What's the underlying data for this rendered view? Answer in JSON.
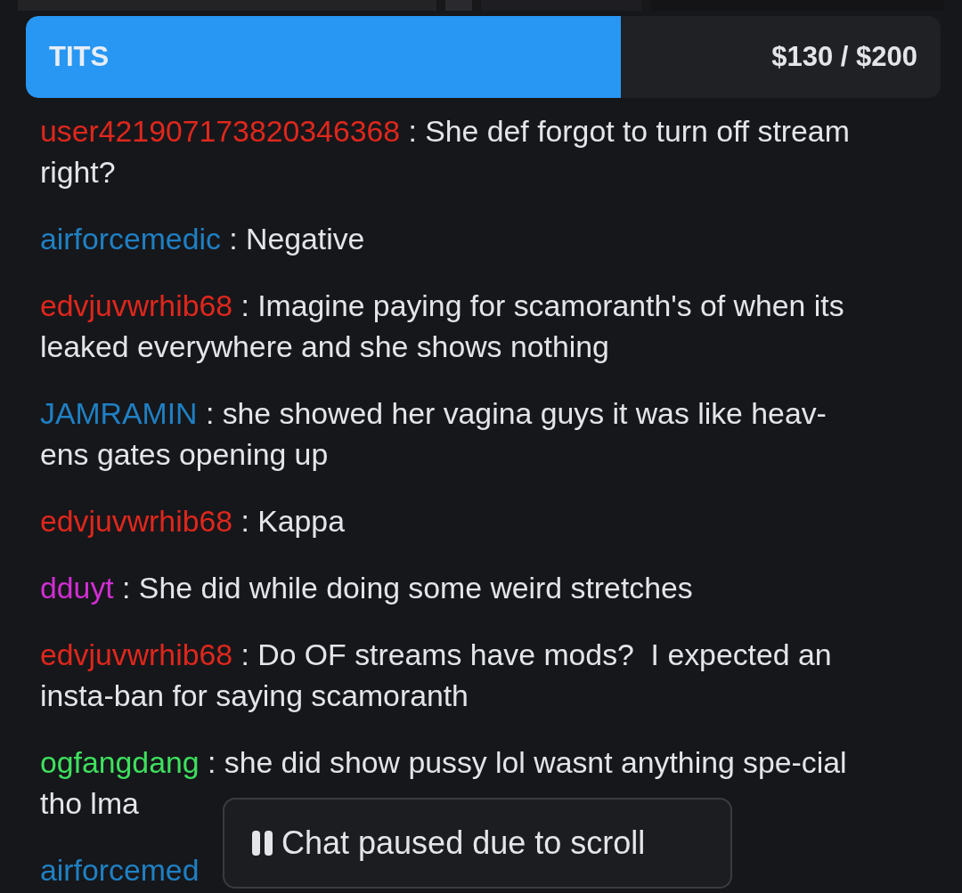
{
  "goal": {
    "label": "TITS",
    "amount": "$130 / $200",
    "level": 0.65
  },
  "messages": [
    {
      "user": "user421907173820346368",
      "color": "#e0271c",
      "text": ": She def forgot to turn off stream right?"
    },
    {
      "user": "airforcemedic",
      "color": "#1f80c4",
      "text": ": Negative"
    },
    {
      "user": "edvjuvwrhib68",
      "color": "#e0271c",
      "text": ": Imagine paying for scamoranth's of when its leaked everywhere and she shows nothing"
    },
    {
      "user": "JAMRAMIN",
      "color": "#1f80c4",
      "text": ": she showed her vagina guys it was like heav-ens gates opening up"
    },
    {
      "user": "edvjuvwrhib68",
      "color": "#e0271c",
      "text": ": Kappa"
    },
    {
      "user": "dduyt",
      "color": "#d22ed3",
      "text": ": She did while doing some weird stretches"
    },
    {
      "user": "edvjuvwrhib68",
      "color": "#e0271c",
      "text": ": Do OF streams have mods?  I expected an insta-ban for saying scamoranth"
    },
    {
      "user": "ogfangdang",
      "color": "#3ee05e",
      "text": ": she did show pussy lol wasnt anything spe-cial tho lma"
    },
    {
      "user": "airforcemed",
      "color": "#1f80c4"
    }
  ],
  "notice": {
    "text": "Chat paused due to scroll"
  }
}
